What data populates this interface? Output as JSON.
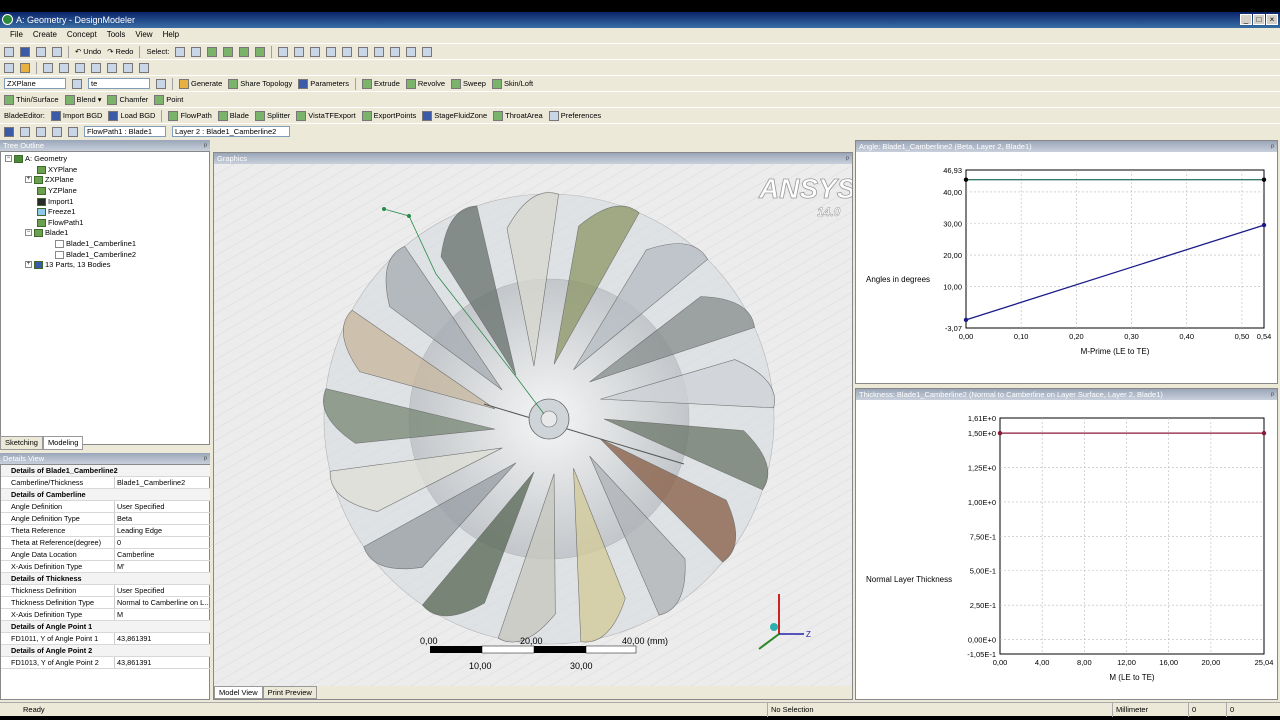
{
  "window": {
    "title": "A: Geometry - DesignModeler"
  },
  "menu": [
    "File",
    "Create",
    "Concept",
    "Tools",
    "View",
    "Help"
  ],
  "toolbar1": {
    "undo": "Undo",
    "redo": "Redo",
    "select": "Select:"
  },
  "toolbar3": {
    "plane": "ZXPlane",
    "sketch": "te",
    "generate": "Generate",
    "share": "Share Topology",
    "params": "Parameters",
    "extrude": "Extrude",
    "revolve": "Revolve",
    "sweep": "Sweep",
    "skin": "Skin/Loft"
  },
  "toolbar4": {
    "thin": "Thin/Surface",
    "blend": "Blend",
    "chamfer": "Chamfer",
    "point": "Point"
  },
  "toolbar5": {
    "bladeeditor": "BladeEditor:",
    "importbgd": "Import BGD",
    "loadbgd": "Load BGD",
    "flowpath": "FlowPath",
    "blade": "Blade",
    "splitter": "Splitter",
    "vista": "VistaTFExport",
    "exportpoints": "ExportPoints",
    "stagefluid": "StageFluidZone",
    "throat": "ThroatArea",
    "prefs": "Preferences"
  },
  "toolbar6": {
    "flowpath_sel": "FlowPath1 : Blade1",
    "layer_sel": "Layer 2 : Blade1_Camberline2"
  },
  "tree": {
    "header": "Tree Outline",
    "nodes": [
      "A: Geometry",
      "XYPlane",
      "ZXPlane",
      "YZPlane",
      "Import1",
      "Freeze1",
      "FlowPath1",
      "Blade1",
      "Blade1_Camberline1",
      "Blade1_Camberline2",
      "13 Parts, 13 Bodies"
    ]
  },
  "lefttabs": [
    "Sketching",
    "Modeling"
  ],
  "details": {
    "header": "Details View",
    "rows": [
      {
        "k": "Details of Blade1_Camberline2",
        "v": "",
        "sec": true
      },
      {
        "k": "Camberline/Thickness",
        "v": "Blade1_Camberline2"
      },
      {
        "k": "Details of Camberline",
        "v": "",
        "sec": true
      },
      {
        "k": "Angle Definition",
        "v": "User Specified"
      },
      {
        "k": "Angle Definition Type",
        "v": "Beta"
      },
      {
        "k": "Theta Reference",
        "v": "Leading Edge"
      },
      {
        "k": "Theta at Reference(degree)",
        "v": "0"
      },
      {
        "k": "Angle Data Location",
        "v": "Camberline"
      },
      {
        "k": "X-Axis Definition Type",
        "v": "M'"
      },
      {
        "k": "Details of Thickness",
        "v": "",
        "sec": true
      },
      {
        "k": "Thickness Definition",
        "v": "User Specified"
      },
      {
        "k": "Thickness Definition Type",
        "v": "Normal to Camberline on L..."
      },
      {
        "k": "X-Axis Definition Type",
        "v": "M"
      },
      {
        "k": "Details of Angle Point 1",
        "v": "",
        "sec": true
      },
      {
        "k": "FD1011, Y of Angle Point 1",
        "v": "43,861391"
      },
      {
        "k": "Details of Angle Point 2",
        "v": "",
        "sec": true
      },
      {
        "k": "FD1013, Y of Angle Point 2",
        "v": "43,861391"
      }
    ]
  },
  "graphics": {
    "header": "Graphics",
    "logo": "ANSYS",
    "version": "14.0",
    "scale": {
      "a": "0,00",
      "b": "20,00",
      "c": "40,00 (mm)",
      "d": "10,00",
      "e": "30,00"
    },
    "tabs": [
      "Model View",
      "Print Preview"
    ]
  },
  "chart_data": [
    {
      "type": "line",
      "header": "Angle: Blade1_Camberline2 (Beta, Layer 2, Blade1)",
      "xlabel": "M-Prime (LE to TE)",
      "ylabel": "Angles in degrees",
      "xlim": [
        0,
        0.54
      ],
      "ylim": [
        -3.07,
        46.93
      ],
      "xticks": [
        "0,00",
        "0,10",
        "0,20",
        "0,30",
        "0,40",
        "0,50",
        "0,54"
      ],
      "yticks": [
        "-3,07",
        "10,00",
        "20,00",
        "30,00",
        "40,00",
        "46,93"
      ],
      "series": [
        {
          "x": [
            0,
            0.54
          ],
          "y": [
            43.861391,
            43.861391
          ],
          "color": "#3a7a6a"
        },
        {
          "x": [
            0,
            0.54
          ],
          "y": [
            -0.5,
            29.5
          ],
          "color": "#1a1a8a"
        }
      ]
    },
    {
      "type": "line",
      "header": "Thickness: Blade1_Camberline2 (Normal to Camberline on Layer Surface, Layer 2, Blade1)",
      "xlabel": "M (LE to TE)",
      "ylabel": "Normal Layer Thickness",
      "xlim": [
        0,
        25.04
      ],
      "ylim": [
        -0.105,
        1.61
      ],
      "xticks": [
        "0,00",
        "4,00",
        "8,00",
        "12,00",
        "16,00",
        "20,00",
        "25,04"
      ],
      "yticks": [
        "-1,05E-1",
        "0,00E+0",
        "2,50E-1",
        "5,00E-1",
        "7,50E-1",
        "1,00E+0",
        "1,25E+0",
        "1,50E+0",
        "1,61E+0"
      ],
      "series": [
        {
          "x": [
            0,
            25.04
          ],
          "y": [
            1.5,
            1.5
          ],
          "color": "#8a1a3a"
        }
      ]
    }
  ],
  "status": {
    "ready": "Ready",
    "selection": "No Selection",
    "units": "Millimeter",
    "v1": "0",
    "v2": "0"
  }
}
